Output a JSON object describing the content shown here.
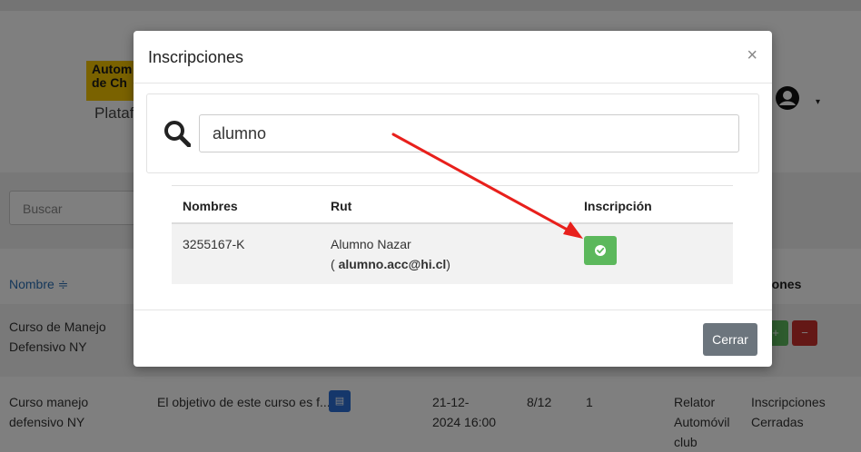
{
  "background": {
    "logo_line1": "Autom",
    "logo_line2": "de Ch",
    "subtitle": "Plataf",
    "search_placeholder": "Buscar",
    "table": {
      "col_name": "Nombre ≑",
      "col_actions": "ciones",
      "row1_name_1": "Curso de Manejo",
      "row1_name_2": "Defensivo NY",
      "row2_name_1": "Curso manejo",
      "row2_name_2": "defensivo NY",
      "row2_desc": "El objetivo de este curso es f...",
      "row2_date_1": "21-12-",
      "row2_date_2": "2024 16:00",
      "row2_slots": "8/12",
      "row2_count": "1",
      "row2_relator_1": "Relator",
      "row2_relator_2": "Automóvil",
      "row2_relator_3": "club",
      "row2_status_1": "Inscripciones",
      "row2_status_2": "Cerradas"
    }
  },
  "modal": {
    "title": "Inscripciones",
    "close_symbol": "×",
    "search_value": "alumno",
    "table": {
      "headers": [
        "Nombres",
        "Rut",
        "Inscripción"
      ],
      "row": {
        "nombres": "3255167-K",
        "rut_name": "Alumno Nazar",
        "rut_email_open": "( ",
        "rut_email": "alumno.acc@hi.cl",
        "rut_email_close": ")"
      }
    },
    "footer_button": "Cerrar"
  },
  "colors": {
    "success": "#5cb85c",
    "danger": "#c9302c",
    "secondary": "#6c757d",
    "link": "#2a6fb5",
    "arrow": "#e8201c",
    "logo": "#f5c400"
  }
}
